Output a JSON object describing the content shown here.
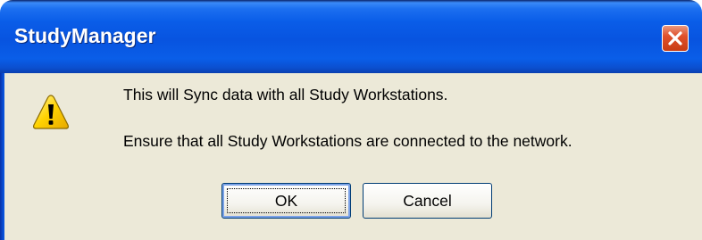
{
  "window": {
    "title": "StudyManager",
    "close_icon": "close-icon"
  },
  "dialog": {
    "icon": "warning-icon",
    "message_line1": "This will Sync data with all Study Workstations.",
    "message_line2": "Ensure that all Study Workstations are connected to the network."
  },
  "buttons": {
    "ok_label": "OK",
    "cancel_label": "Cancel"
  },
  "colors": {
    "titlebar": "#0a5ee8",
    "close_button": "#e0512c",
    "dialog_background": "#ece9d8",
    "button_border": "#003c74",
    "warning_fill": "#ffd200"
  }
}
